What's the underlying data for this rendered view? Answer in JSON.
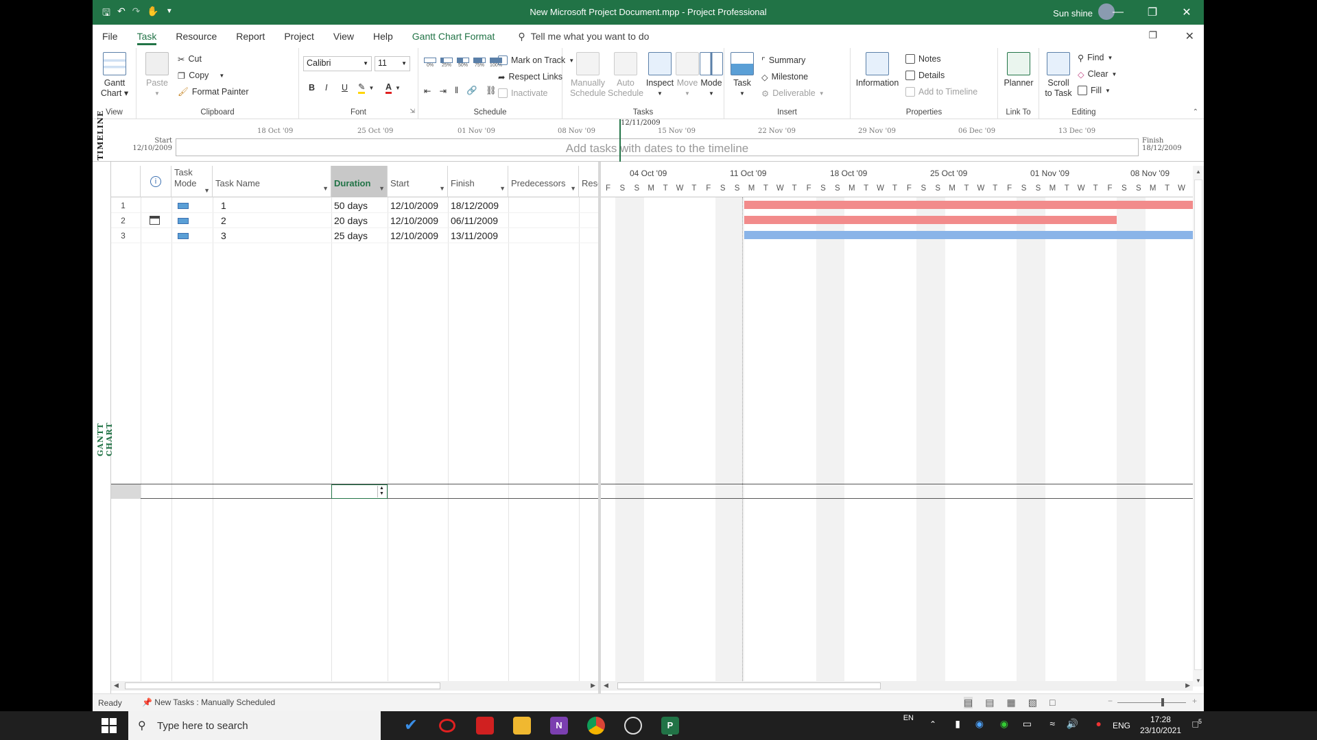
{
  "window": {
    "title": "New Microsoft Project Document.mpp  -  Project Professional",
    "user": "Sun shine"
  },
  "tabs": [
    {
      "label": "File"
    },
    {
      "label": "Task",
      "active": true
    },
    {
      "label": "Resource"
    },
    {
      "label": "Report"
    },
    {
      "label": "Project"
    },
    {
      "label": "View"
    },
    {
      "label": "Help"
    },
    {
      "label": "Gantt Chart Format"
    }
  ],
  "tellme": "Tell me what you want to do",
  "ribbon": {
    "view": {
      "label": "View",
      "gantt": "Gantt",
      "gantt2": "Chart"
    },
    "clipboard": {
      "label": "Clipboard",
      "paste": "Paste",
      "cut": "Cut",
      "copy": "Copy",
      "format_painter": "Format Painter"
    },
    "font": {
      "label": "Font",
      "family": "Calibri",
      "size": "11",
      "bold": "B",
      "italic": "I",
      "underline": "U"
    },
    "schedule": {
      "label": "Schedule",
      "mark_on_track": "Mark on Track",
      "respect_links": "Respect Links",
      "inactivate": "Inactivate",
      "pcts": [
        "0%",
        "25%",
        "50%",
        "75%",
        "100%"
      ]
    },
    "tasks": {
      "label": "Tasks",
      "manual1": "Manually",
      "manual2": "Schedule",
      "auto1": "Auto",
      "auto2": "Schedule",
      "inspect": "Inspect",
      "move": "Move",
      "mode": "Mode"
    },
    "insert": {
      "label": "Insert",
      "task": "Task",
      "summary": "Summary",
      "milestone": "Milestone",
      "deliverable": "Deliverable"
    },
    "properties": {
      "label": "Properties",
      "information": "Information",
      "notes": "Notes",
      "details": "Details",
      "add_timeline": "Add to Timeline"
    },
    "linkto": {
      "label": "Link To",
      "planner": "Planner"
    },
    "editing": {
      "label": "Editing",
      "scroll1": "Scroll",
      "scroll2": "to Task",
      "find": "Find",
      "clear": "Clear",
      "fill": "Fill"
    }
  },
  "timeline": {
    "side_label": "TIMELINE",
    "today": "12/11/2009",
    "start_label": "Start",
    "start_date": "12/10/2009",
    "finish_label": "Finish",
    "finish_date": "18/12/2009",
    "placeholder": "Add tasks with dates to the timeline",
    "ticks": [
      "18 Oct '09",
      "25 Oct '09",
      "01 Nov '09",
      "08 Nov '09",
      "15 Nov '09",
      "22 Nov '09",
      "29 Nov '09",
      "06 Dec '09",
      "13 Dec '09"
    ]
  },
  "view_label": "GANTT CHART",
  "table": {
    "headers": {
      "mode1": "Task",
      "mode2": "Mode",
      "name": "Task Name",
      "duration": "Duration",
      "start": "Start",
      "finish": "Finish",
      "pred": "Predecessors",
      "res": "Reso"
    },
    "rows": [
      {
        "num": "1",
        "name": "1",
        "duration": "50 days",
        "start": "12/10/2009",
        "finish": "18/12/2009",
        "calendar": false
      },
      {
        "num": "2",
        "name": "2",
        "duration": "20 days",
        "start": "12/10/2009",
        "finish": "06/11/2009",
        "calendar": true
      },
      {
        "num": "3",
        "name": "3",
        "duration": "25 days",
        "start": "12/10/2009",
        "finish": "13/11/2009",
        "calendar": false
      }
    ]
  },
  "gantt": {
    "weeks": [
      "04 Oct '09",
      "11 Oct '09",
      "18 Oct '09",
      "25 Oct '09",
      "01 Nov '09",
      "08 Nov '09"
    ],
    "day_letters": [
      "F",
      "S",
      "S",
      "M",
      "T",
      "W",
      "T",
      "F",
      "S",
      "S",
      "M",
      "T",
      "W",
      "T",
      "F",
      "S",
      "S",
      "M",
      "T",
      "W",
      "T",
      "F",
      "S",
      "S",
      "M",
      "T",
      "W",
      "T",
      "F",
      "S",
      "S",
      "M",
      "T",
      "W",
      "T",
      "F",
      "S",
      "S",
      "M",
      "T",
      "W"
    ],
    "bar_colors": [
      "#f28b8b",
      "#f28b8b",
      "#8ab4e8"
    ]
  },
  "status": {
    "ready": "Ready",
    "new_tasks": "New Tasks : Manually Scheduled"
  },
  "taskbar": {
    "search_placeholder": "Type here to search",
    "lang1": "EN",
    "lang2": "ENG",
    "time": "17:28",
    "date": "23/10/2021",
    "notif": "5"
  }
}
